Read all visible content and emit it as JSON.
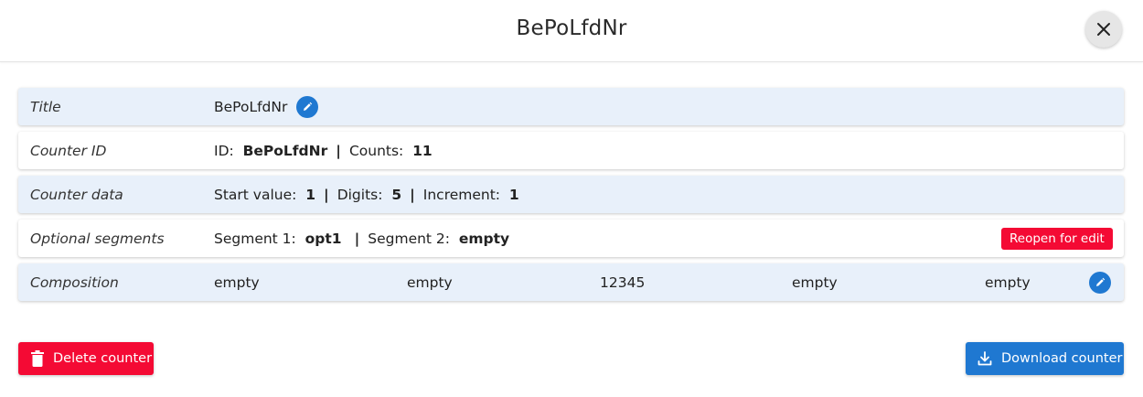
{
  "dialog": {
    "title": "BePoLfdNr"
  },
  "rows": {
    "title": {
      "label": "Title",
      "value": "BePoLfdNr"
    },
    "counter_id": {
      "label": "Counter ID",
      "id_label": "ID:",
      "id_value": "BePoLfdNr",
      "sep": "|",
      "counts_label": "Counts:",
      "counts_value": "11"
    },
    "counter_data": {
      "label": "Counter data",
      "start_label": "Start value:",
      "start_value": "1",
      "sep": "|",
      "digits_label": "Digits:",
      "digits_value": "5",
      "increment_label": "Increment:",
      "increment_value": "1"
    },
    "optional_segments": {
      "label": "Optional segments",
      "seg1_label": "Segment 1:",
      "seg1_value": "opt1",
      "sep": "|",
      "seg2_label": "Segment 2:",
      "seg2_value": "empty",
      "reopen_label": "Reopen for edit"
    },
    "composition": {
      "label": "Composition",
      "parts": [
        "empty",
        "empty",
        "12345",
        "empty",
        "empty"
      ]
    }
  },
  "actions": {
    "delete_label": "Delete counter",
    "download_label": "Download counter"
  },
  "icons": {
    "close": "close-icon",
    "edit": "pencil-icon",
    "delete": "trash-icon",
    "download": "download-icon"
  },
  "colors": {
    "primary": "#1f78d1",
    "danger": "#f40a34",
    "row_shade": "#e8f0fa"
  }
}
